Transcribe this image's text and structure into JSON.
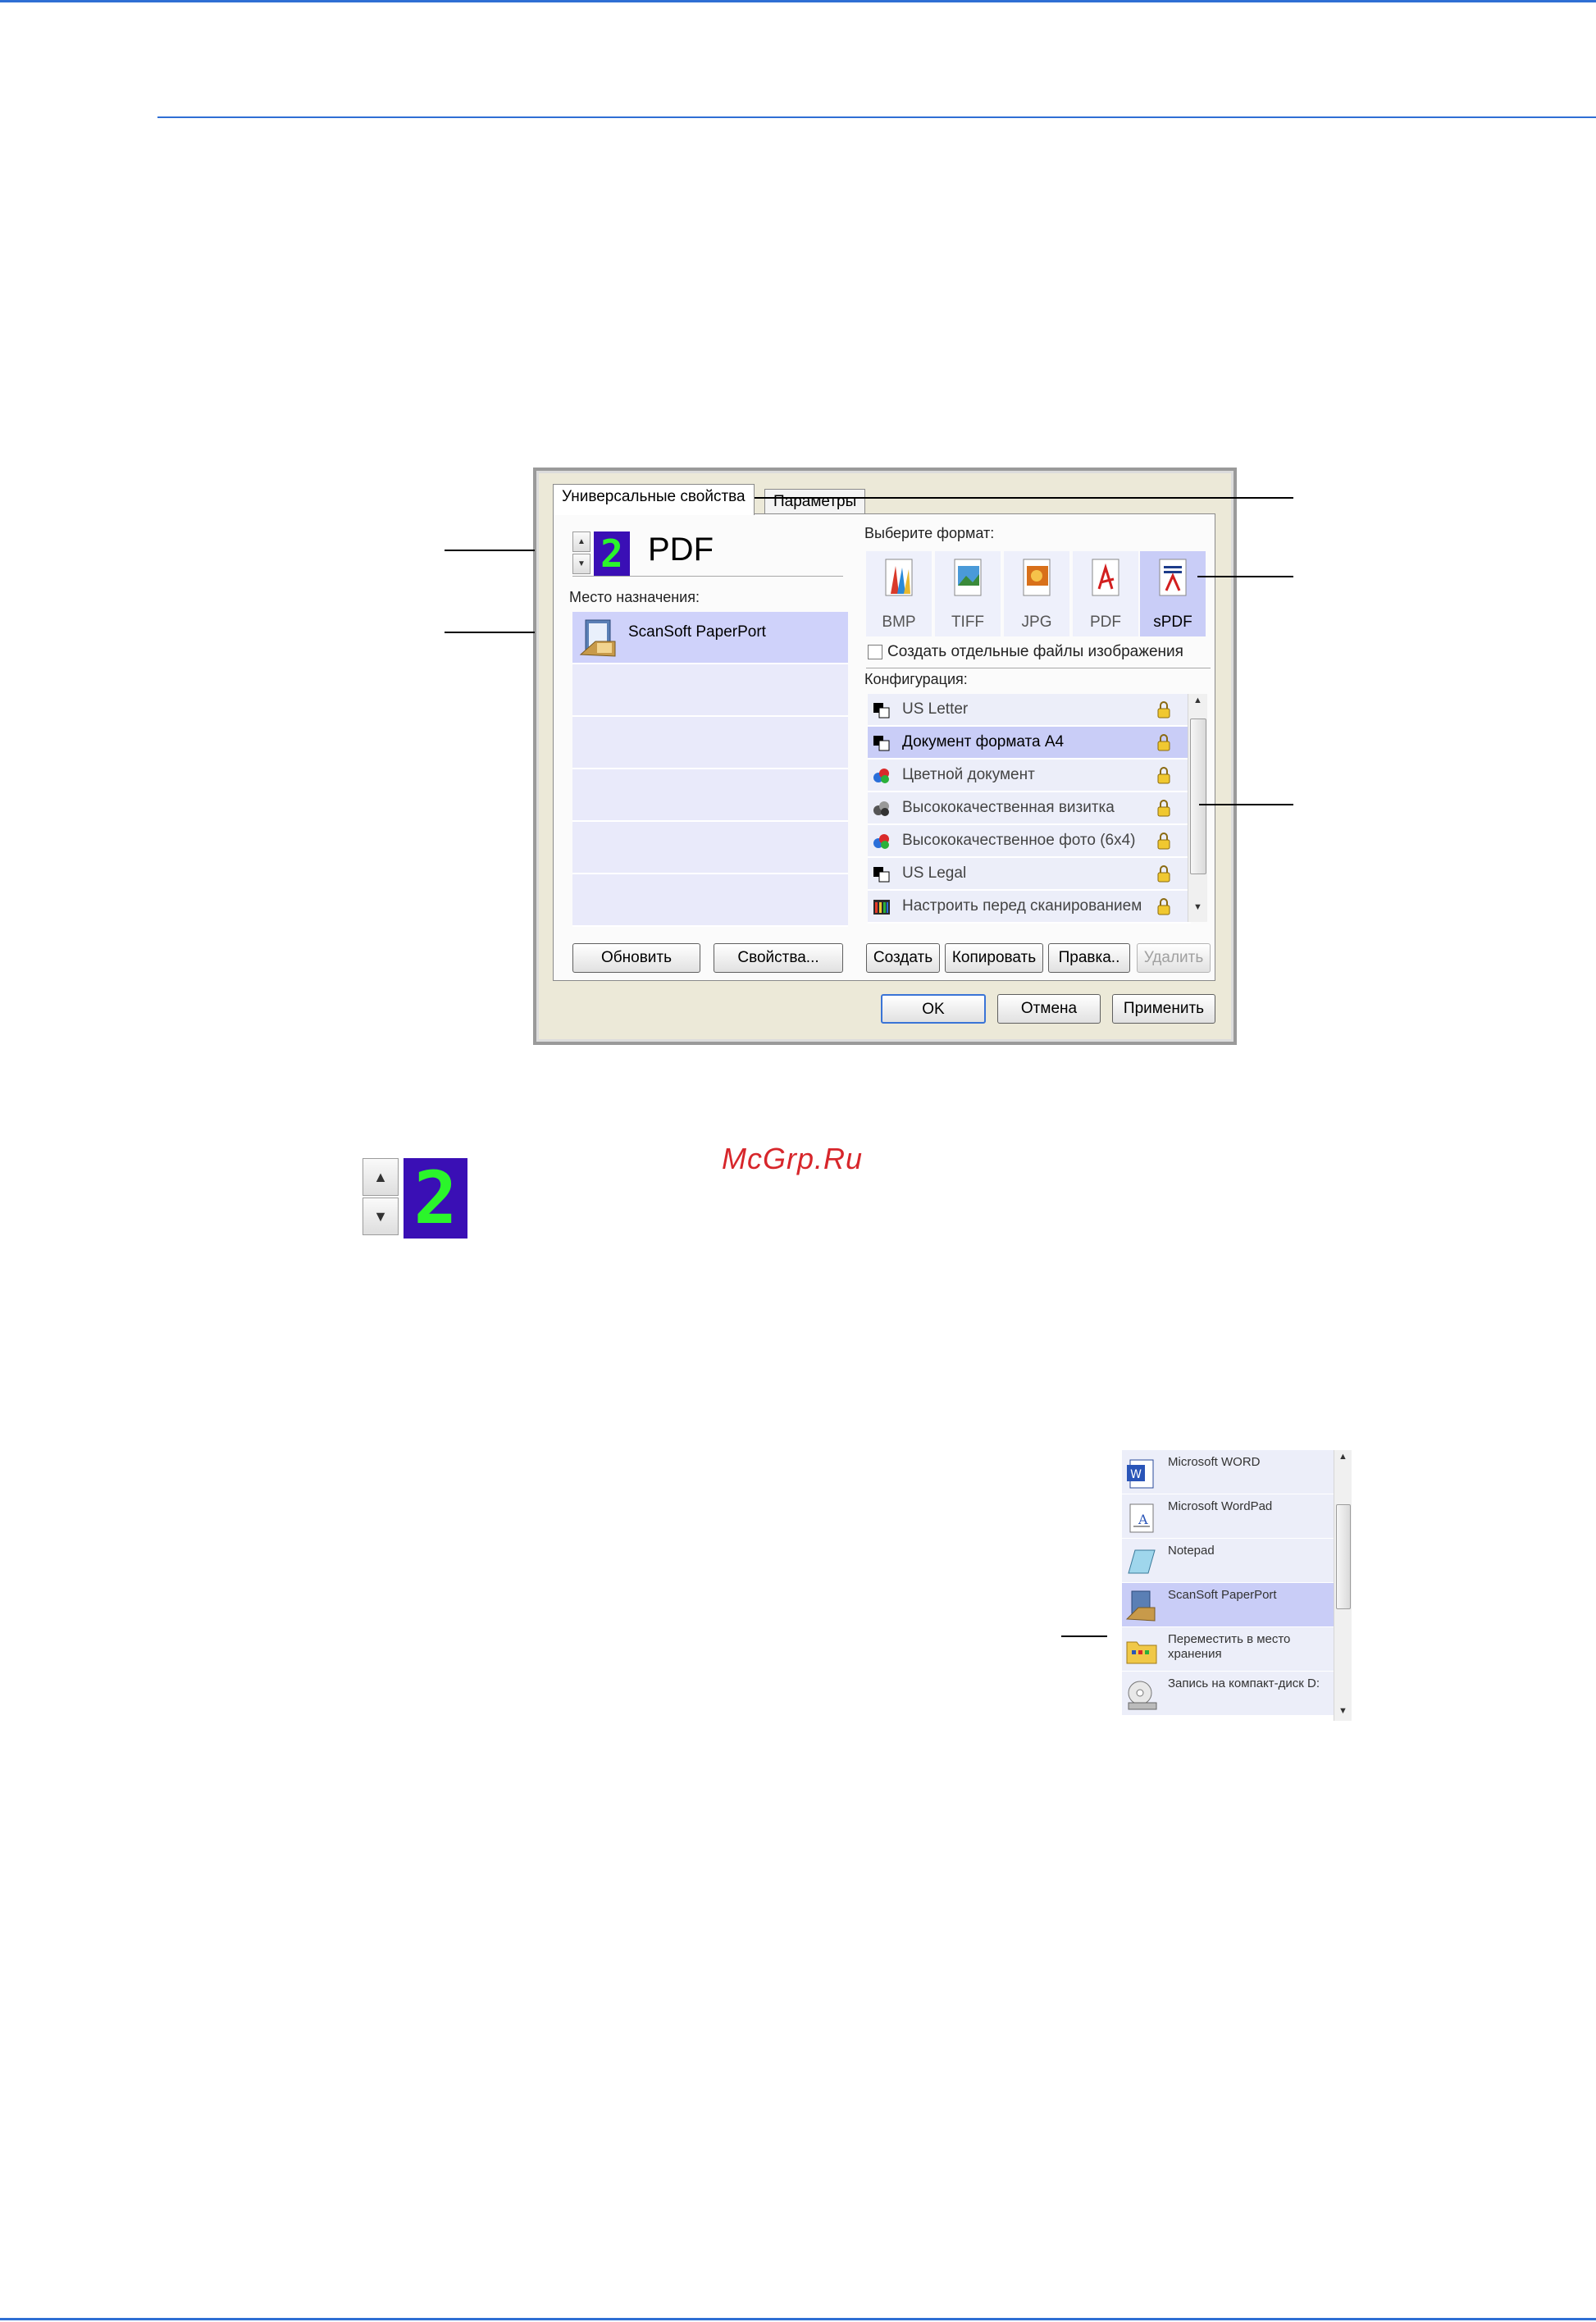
{
  "dialog": {
    "tabs": [
      "Универсальные свойства",
      "Параметры"
    ],
    "selector_number": "2",
    "format_name": "PDF",
    "destination_label": "Место назначения:",
    "destinations": [
      "ScanSoft PaperPort"
    ],
    "format_label": "Выберите формат:",
    "formats": [
      "BMP",
      "TIFF",
      "JPG",
      "PDF",
      "sPDF"
    ],
    "selected_format": "sPDF",
    "separate_files_label": "Создать отдельные файлы изображения",
    "config_label": "Конфигурация:",
    "configs": [
      {
        "name": "US Letter",
        "icon": "bw-doc-icon"
      },
      {
        "name": "Документ формата A4",
        "icon": "bw-doc-icon"
      },
      {
        "name": "Цветной документ",
        "icon": "color-doc-icon"
      },
      {
        "name": "Высококачественная визитка",
        "icon": "gray-doc-icon"
      },
      {
        "name": "Высококачественное фото (6x4)",
        "icon": "color-doc-icon"
      },
      {
        "name": "US Legal",
        "icon": "bw-doc-icon"
      },
      {
        "name": "Настроить перед сканированием",
        "icon": "configure-icon"
      }
    ],
    "selected_config": "Документ формата A4",
    "left_buttons": {
      "refresh": "Обновить",
      "properties": "Свойства..."
    },
    "config_buttons": {
      "new": "Создать",
      "copy": "Копировать",
      "edit": "Правка..",
      "delete": "Удалить"
    },
    "bottom_buttons": {
      "ok": "OK",
      "cancel": "Отмена",
      "apply": "Применить"
    }
  },
  "spinner_closeup": {
    "number": "2"
  },
  "watermark": "McGrp.Ru",
  "app_list": {
    "items": [
      {
        "name": "Microsoft WORD",
        "icon": "word-icon"
      },
      {
        "name": "Microsoft WordPad",
        "icon": "wordpad-icon"
      },
      {
        "name": "Notepad",
        "icon": "notepad-icon"
      },
      {
        "name": "ScanSoft PaperPort",
        "icon": "paperport-icon"
      },
      {
        "name": "Переместить в место хранения",
        "icon": "storage-folder-icon"
      },
      {
        "name": "Запись на компакт-диск D:",
        "icon": "cd-burn-icon"
      }
    ],
    "selected": "ScanSoft PaperPort"
  },
  "colors": {
    "accent_rule": "#2f6fd4",
    "selection": "#c9cdf7",
    "digit_bg": "#3a0fb5",
    "digit_fg": "#2bf52b"
  }
}
